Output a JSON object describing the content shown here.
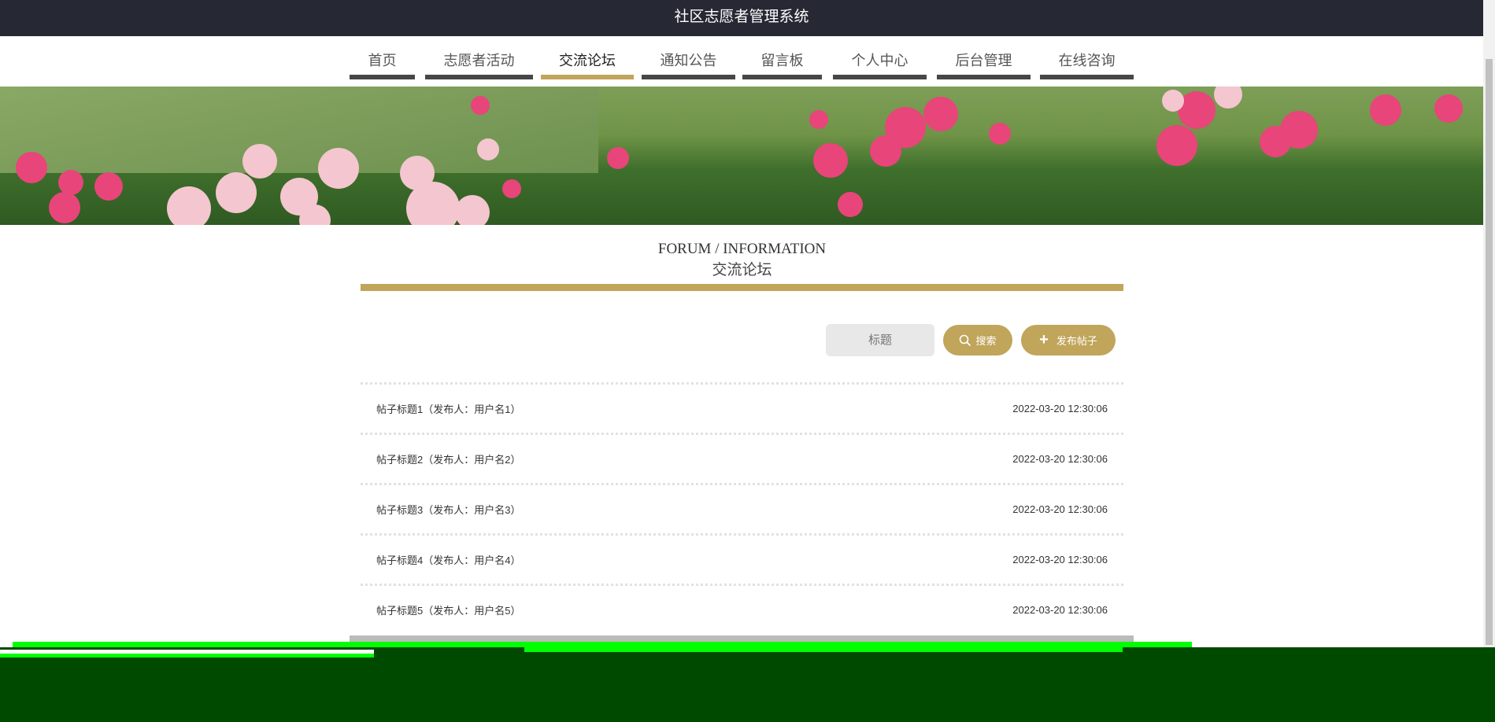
{
  "header": {
    "title": "社区志愿者管理系统"
  },
  "nav": {
    "items": [
      {
        "label": "首页"
      },
      {
        "label": "志愿者活动"
      },
      {
        "label": "交流论坛"
      },
      {
        "label": "通知公告"
      },
      {
        "label": "留言板"
      },
      {
        "label": "个人中心"
      },
      {
        "label": "后台管理"
      },
      {
        "label": "在线咨询"
      }
    ],
    "active": "交流论坛"
  },
  "section": {
    "title_en": "FORUM / INFORMATION",
    "title_cn": "交流论坛"
  },
  "search": {
    "placeholder": "标题",
    "search_label": "搜索",
    "publish_label": "发布帖子"
  },
  "posts": [
    {
      "title": "帖子标题1（发布人：用户名1）",
      "time": "2022-03-20 12:30:06"
    },
    {
      "title": "帖子标题2（发布人：用户名2）",
      "time": "2022-03-20 12:30:06"
    },
    {
      "title": "帖子标题3（发布人：用户名3）",
      "time": "2022-03-20 12:30:06"
    },
    {
      "title": "帖子标题4（发布人：用户名4）",
      "time": "2022-03-20 12:30:06"
    },
    {
      "title": "帖子标题5（发布人：用户名5）",
      "time": "2022-03-20 12:30:06"
    }
  ],
  "colors": {
    "accent": "#c0a55a",
    "topbar": "#262833",
    "nav_bar": "#47474a"
  }
}
